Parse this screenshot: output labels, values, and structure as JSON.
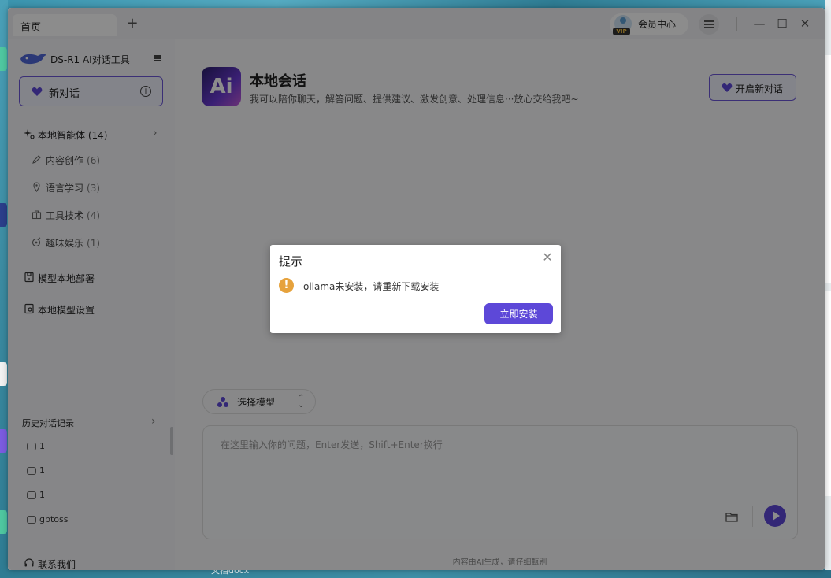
{
  "window": {
    "tab_home": "首页",
    "tab_add": "+",
    "vip_label": "会员中心",
    "vip_badge": "VIP",
    "minimize": "—",
    "maximize": "☐",
    "close": "✕"
  },
  "sidebar": {
    "app_name": "DS-R1 AI对话工具",
    "new_chat": "新对话",
    "agents_label": "本地智能体",
    "agents_count": "(14)",
    "categories": [
      {
        "label": "内容创作",
        "count": "(6)"
      },
      {
        "label": "语言学习",
        "count": "(3)"
      },
      {
        "label": "工具技术",
        "count": "(4)"
      },
      {
        "label": "趣味娱乐",
        "count": "(1)"
      }
    ],
    "deploy": "模型本地部署",
    "settings": "本地模型设置",
    "history_label": "历史对话记录",
    "history": [
      "1",
      "1",
      "1",
      "gptoss"
    ],
    "contact": "联系我们"
  },
  "main": {
    "logo_text": "Ai",
    "title": "本地会话",
    "subtitle": "我可以陪你聊天，解答问题、提供建议、激发创意、处理信息···放心交给我吧~",
    "start_new": "开启新对话",
    "model_select": "选择模型",
    "input_placeholder": "在这里输入你的问题，Enter发送，Shift+Enter换行",
    "footer": "内容由AI生成，请仔细甄别"
  },
  "dialog": {
    "title": "提示",
    "icon_text": "!",
    "message": "ollama未安装，请重新下载安装",
    "button": "立即安装",
    "close": "✕"
  },
  "desktop": {
    "bottom_text": "文档docx"
  },
  "colors": {
    "accent": "#5d48d8",
    "warning": "#e6a23c"
  }
}
